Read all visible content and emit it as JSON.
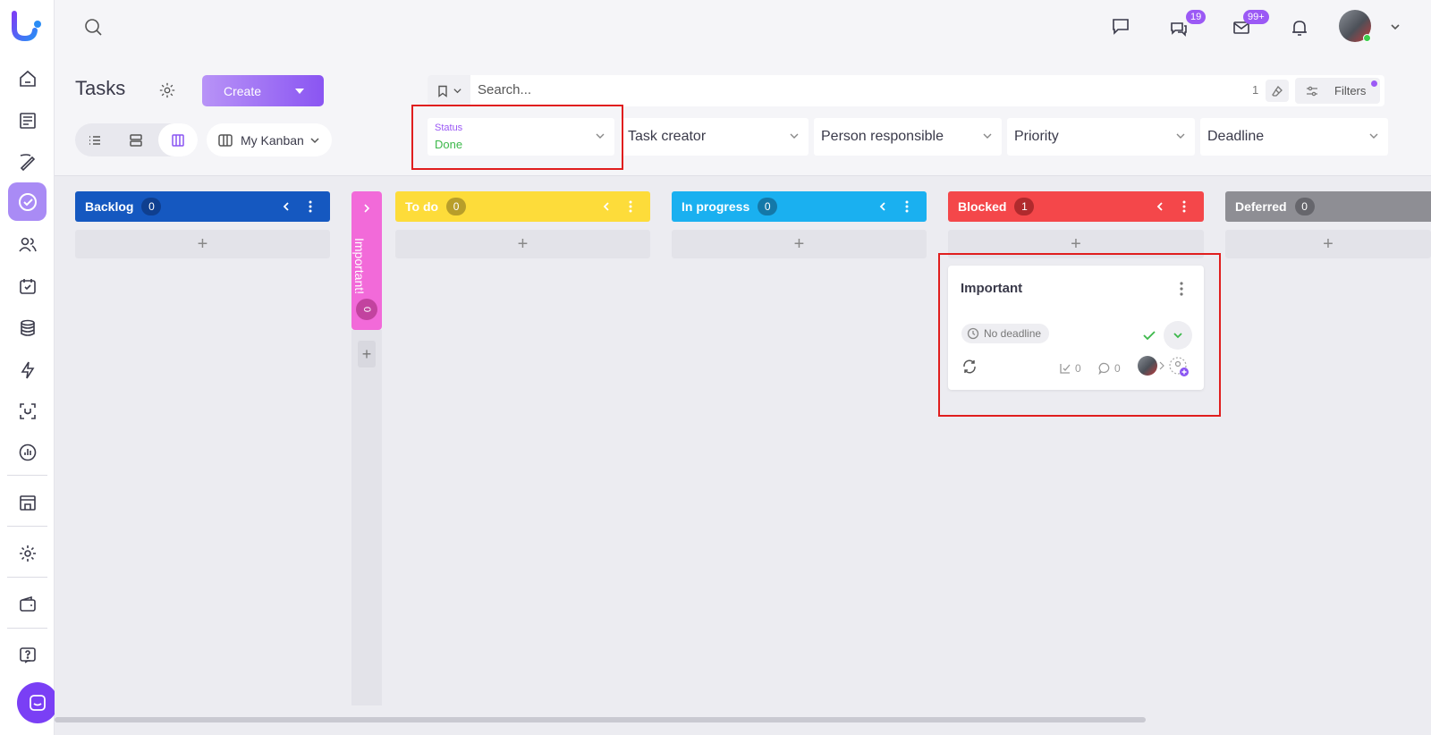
{
  "app": {
    "accent": "#9b59f5"
  },
  "topbar": {
    "chat_badge": "19",
    "mail_badge": "99+"
  },
  "header": {
    "title": "Tasks",
    "create_label": "Create",
    "kanban_label": "My Kanban"
  },
  "search": {
    "placeholder": "Search...",
    "count": "1",
    "filters_label": "Filters"
  },
  "filters": {
    "status_label": "Status",
    "status_value": "Done",
    "task_creator": "Task creator",
    "person_responsible": "Person responsible",
    "priority": "Priority",
    "deadline": "Deadline"
  },
  "columns": [
    {
      "name": "Backlog",
      "count": "0",
      "color": "#1558c0"
    },
    {
      "name": "Important!",
      "count": "0",
      "color": "#f26ad9"
    },
    {
      "name": "To do",
      "count": "0",
      "color": "#fddc3a"
    },
    {
      "name": "In progress",
      "count": "0",
      "color": "#1ab0f0"
    },
    {
      "name": "Blocked",
      "count": "1",
      "color": "#f4474a"
    },
    {
      "name": "Deferred",
      "count": "0",
      "color": "#8e8e94"
    }
  ],
  "card": {
    "title": "Important",
    "deadline": "No deadline",
    "checklist_count": "0",
    "comments_count": "0"
  }
}
